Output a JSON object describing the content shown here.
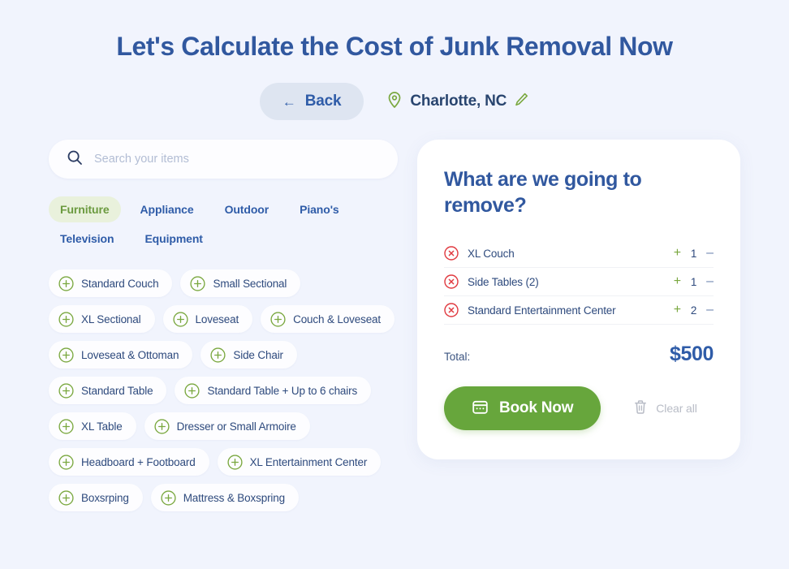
{
  "header": {
    "title": "Let's Calculate the Cost of Junk Removal Now",
    "back_label": "Back",
    "back_arrow": "←",
    "location": "Charlotte, NC"
  },
  "search": {
    "placeholder": "Search your items",
    "value": ""
  },
  "categories": [
    {
      "label": "Furniture",
      "active": true
    },
    {
      "label": "Appliance",
      "active": false
    },
    {
      "label": "Outdoor",
      "active": false
    },
    {
      "label": "Piano's",
      "active": false
    },
    {
      "label": "Television",
      "active": false
    },
    {
      "label": "Equipment",
      "active": false
    }
  ],
  "items": [
    {
      "label": "Standard Couch"
    },
    {
      "label": "Small Sectional"
    },
    {
      "label": "XL Sectional"
    },
    {
      "label": "Loveseat"
    },
    {
      "label": "Couch & Loveseat"
    },
    {
      "label": "Loveseat & Ottoman"
    },
    {
      "label": "Side Chair"
    },
    {
      "label": "Standard Table"
    },
    {
      "label": "Standard Table + Up to 6 chairs"
    },
    {
      "label": "XL Table"
    },
    {
      "label": "Dresser or Small Armoire"
    },
    {
      "label": "Headboard + Footboard"
    },
    {
      "label": "XL Entertainment Center"
    },
    {
      "label": "Boxsrping"
    },
    {
      "label": "Mattress & Boxspring"
    }
  ],
  "cart": {
    "title": "What are we going to remove?",
    "rows": [
      {
        "name": "XL Couch",
        "qty": "1",
        "plus": "+",
        "minus": "–"
      },
      {
        "name": "Side Tables (2)",
        "qty": "1",
        "plus": "+",
        "minus": "–"
      },
      {
        "name": "Standard Entertainment Center",
        "qty": "2",
        "plus": "+",
        "minus": "–"
      }
    ],
    "total_label": "Total:",
    "total_value": "$500",
    "book_label": "Book Now",
    "clear_label": "Clear all"
  },
  "colors": {
    "page_background": "#f1f4fd",
    "primary_blue": "#31589f",
    "text_navy": "#2e4a7d",
    "accent_green": "#67a63c",
    "chip_plus_green": "#7aa83f",
    "remove_red": "#e0393f",
    "back_pill": "#dee5f1",
    "active_tab_pill": "#e9f1dc",
    "muted_gray": "#b8bcc6"
  }
}
